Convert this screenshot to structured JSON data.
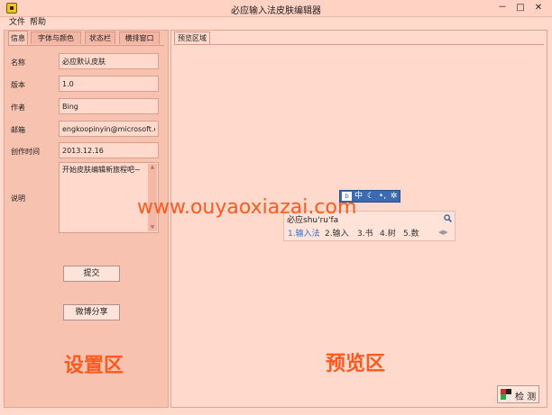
{
  "window": {
    "title": "必应输入法皮肤编辑器",
    "minimize": "－",
    "maximize": "□",
    "close": "✕"
  },
  "menu": {
    "file": "文件",
    "help": "帮助"
  },
  "settings": {
    "tabs": [
      "信息",
      "字体与颜色",
      "状态栏",
      "横排窗口"
    ],
    "fields": {
      "name_label": "名称",
      "name_value": "必应默认皮肤",
      "version_label": "版本",
      "version_value": "1.0",
      "author_label": "作者",
      "author_value": "Bing",
      "email_label": "邮箱",
      "email_value": "engkoopinyin@microsoft.com",
      "created_label": "创作时间",
      "created_value": "2013.12.16",
      "desc_label": "说明",
      "desc_value": "开始皮肤编辑新旅程吧~"
    },
    "buttons": {
      "submit": "提交",
      "share": "微博分享"
    },
    "zone_label": "设置区"
  },
  "preview": {
    "tab": "预览区域",
    "zone_label": "预览区",
    "status_bar": {
      "logo": "b",
      "lang": "中",
      "mode": "☾",
      "punct": "•,",
      "settings": "✲"
    },
    "composition": "必应shu'ru'fa",
    "candidates": [
      "1.输入法",
      "2.输入",
      "3.书",
      "4.树",
      "5.数"
    ],
    "nav_arrows": "◀▶"
  },
  "watermark": "www.ouyaoxiazai.com",
  "detect_button": "检 测",
  "colors": {
    "accent": "#ff5a1e",
    "status_bar": "#3c6bb3",
    "candidate_highlight": "#3a6fc4"
  }
}
